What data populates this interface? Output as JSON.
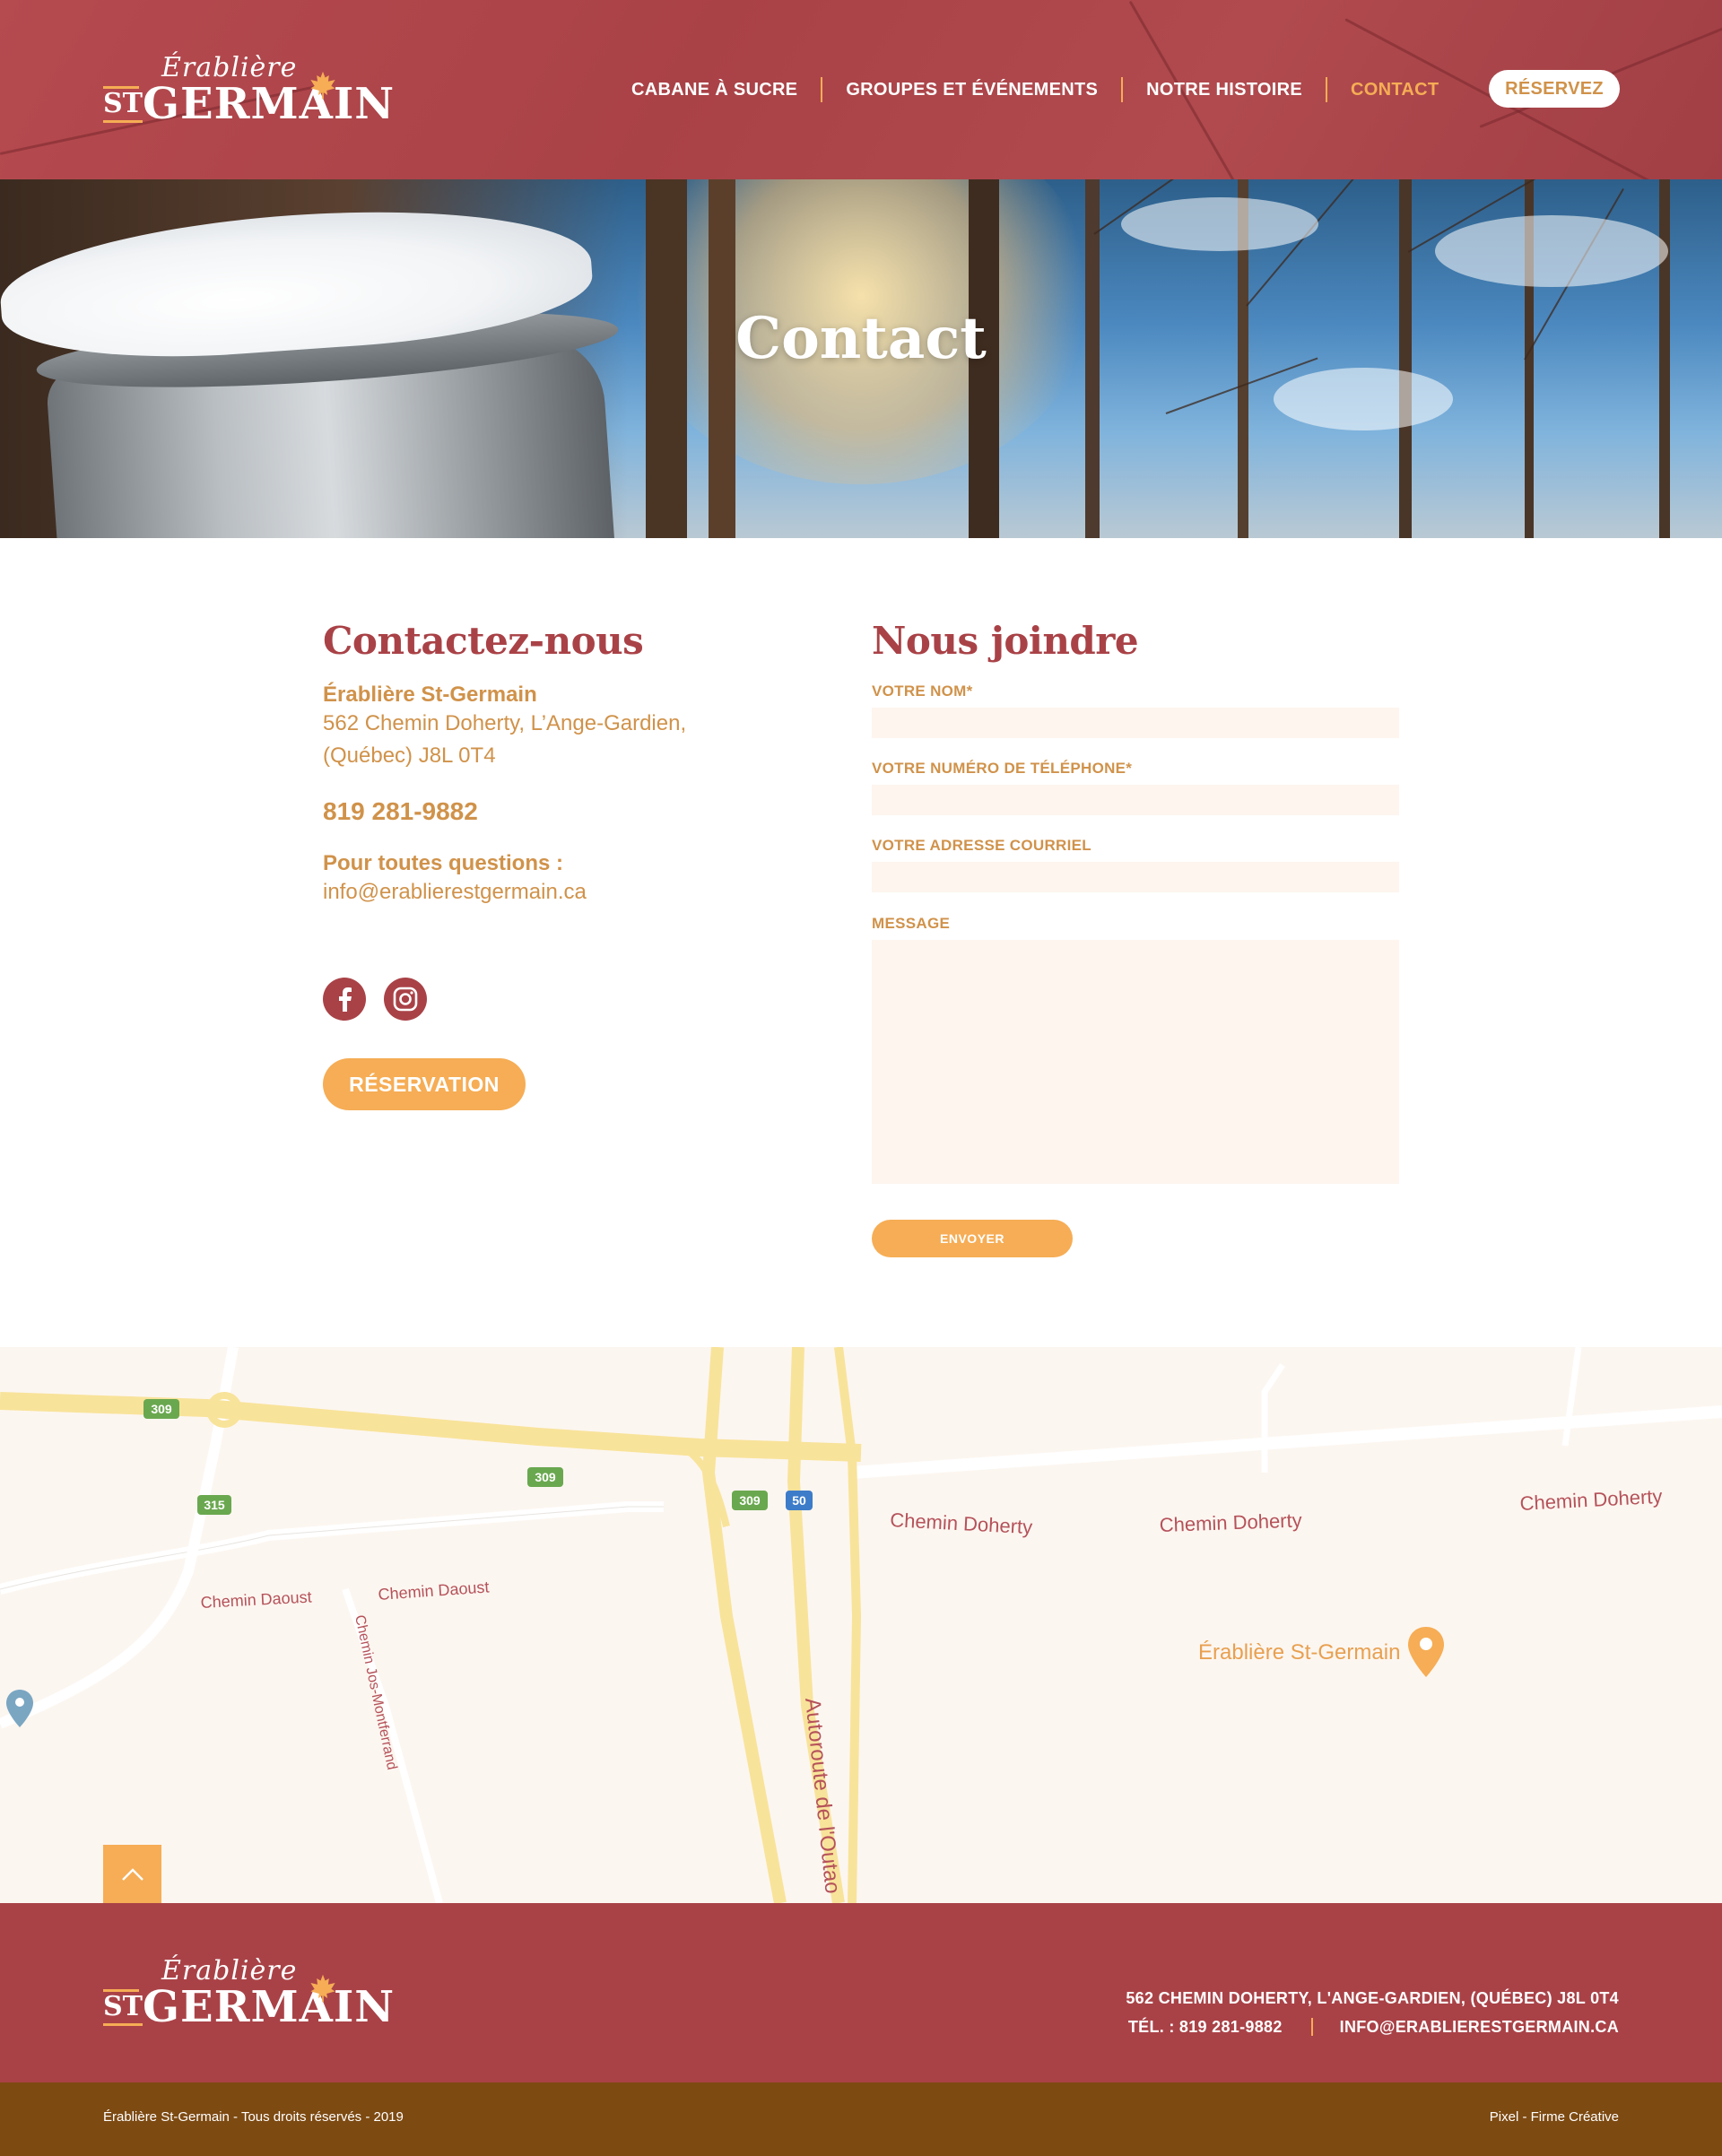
{
  "brand": {
    "script": "Érablière",
    "st": "ST",
    "name": "GERMAIN"
  },
  "nav": {
    "items": [
      {
        "label": "CABANE À SUCRE",
        "active": false
      },
      {
        "label": "GROUPES ET ÉVÉNEMENTS",
        "active": false
      },
      {
        "label": "NOTRE HISTOIRE",
        "active": false
      },
      {
        "label": "CONTACT",
        "active": true
      }
    ],
    "cta": "RÉSERVEZ"
  },
  "hero": {
    "title": "Contact"
  },
  "contact": {
    "heading": "Contactez-nous",
    "company": "Érablière St-Germain",
    "address_line1": "562 Chemin Doherty, L’Ange-Gardien,",
    "address_line2": "(Québec)  J8L 0T4",
    "phone": "819 281-9882",
    "questions_label": "Pour toutes questions :",
    "email": "info@erablierestgermain.ca",
    "social": [
      "facebook-icon",
      "instagram-icon"
    ],
    "reservation_button": "RÉSERVATION"
  },
  "form": {
    "heading": "Nous joindre",
    "name_label": "VOTRE NOM*",
    "phone_label": "VOTRE NUMÉRO DE TÉLÉPHONE*",
    "email_label": "VOTRE ADRESSE COURRIEL",
    "message_label": "MESSAGE",
    "submit": "ENVOYER"
  },
  "map": {
    "labels": {
      "doherty_1": "Chemin Doherty",
      "doherty_2": "Chemin Doherty",
      "doherty_3": "Chemin Doherty",
      "daoust_1": "Chemin Daoust",
      "daoust_2": "Chemin Daoust",
      "montferrand": "Chemin Jos-Montferrand",
      "autoroute": "Autoroute de l'Outao",
      "place": "Érablière St-Germain"
    },
    "shields": {
      "r309a": "309",
      "r309b": "309",
      "r309c": "309",
      "r315": "315",
      "a50": "50"
    },
    "colors": {
      "highway": "#f8e39a",
      "road": "#ffffff",
      "label": "#b5525a",
      "pin": "#f6ad55"
    }
  },
  "footer": {
    "address": "562 CHEMIN DOHERTY, L'ANGE-GARDIEN, (QUÉBEC)  J8L 0T4",
    "phone": "TÉL. : 819 281-9882",
    "email": "INFO@ERABLIERESTGERMAIN.CA",
    "copyright": "Érablière St-Germain - Tous droits réservés - 2019",
    "credit": "Pixel - Firme Créative"
  },
  "colors": {
    "primary": "#a94247",
    "accent": "#f6ad55",
    "text": "#d0924a",
    "bottom_bar": "#7d4a12"
  }
}
